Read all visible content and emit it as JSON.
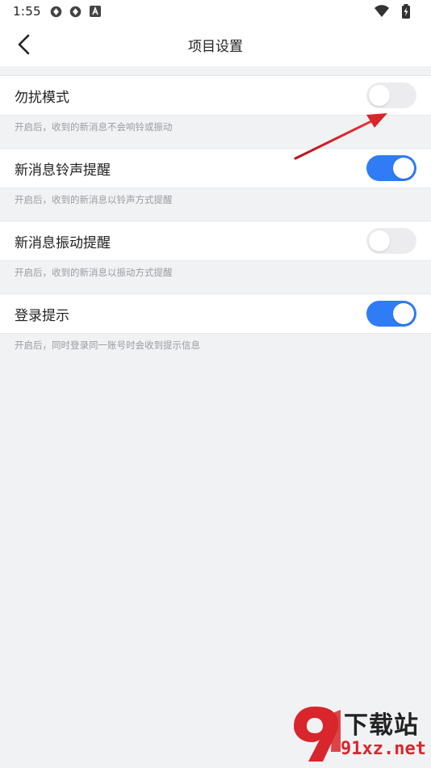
{
  "status_bar": {
    "time": "1:55",
    "icons_left": [
      "sync-icon",
      "sync-icon",
      "notification-a-icon"
    ],
    "icons_right": [
      "wifi-icon",
      "battery-charging-icon"
    ]
  },
  "header": {
    "title": "项目设置",
    "back_icon": "chevron-left-icon"
  },
  "settings": [
    {
      "label": "勿扰模式",
      "hint": "开启后，收到的新消息不会响铃或振动",
      "enabled": false
    },
    {
      "label": "新消息铃声提醒",
      "hint": "开启后，收到的新消息以铃声方式提醒",
      "enabled": true
    },
    {
      "label": "新消息振动提醒",
      "hint": "开启后，收到的新消息以振动方式提醒",
      "enabled": false
    },
    {
      "label": "登录提示",
      "hint": "开启后，同时登录同一账号时会收到提示信息",
      "enabled": true
    }
  ],
  "colors": {
    "accent": "#2f7cf6",
    "toggle_off": "#ececee",
    "background": "#f1f2f4",
    "annotation_arrow": "#d8262c"
  },
  "watermark": {
    "title": "下载站",
    "url": "91xz.net"
  }
}
